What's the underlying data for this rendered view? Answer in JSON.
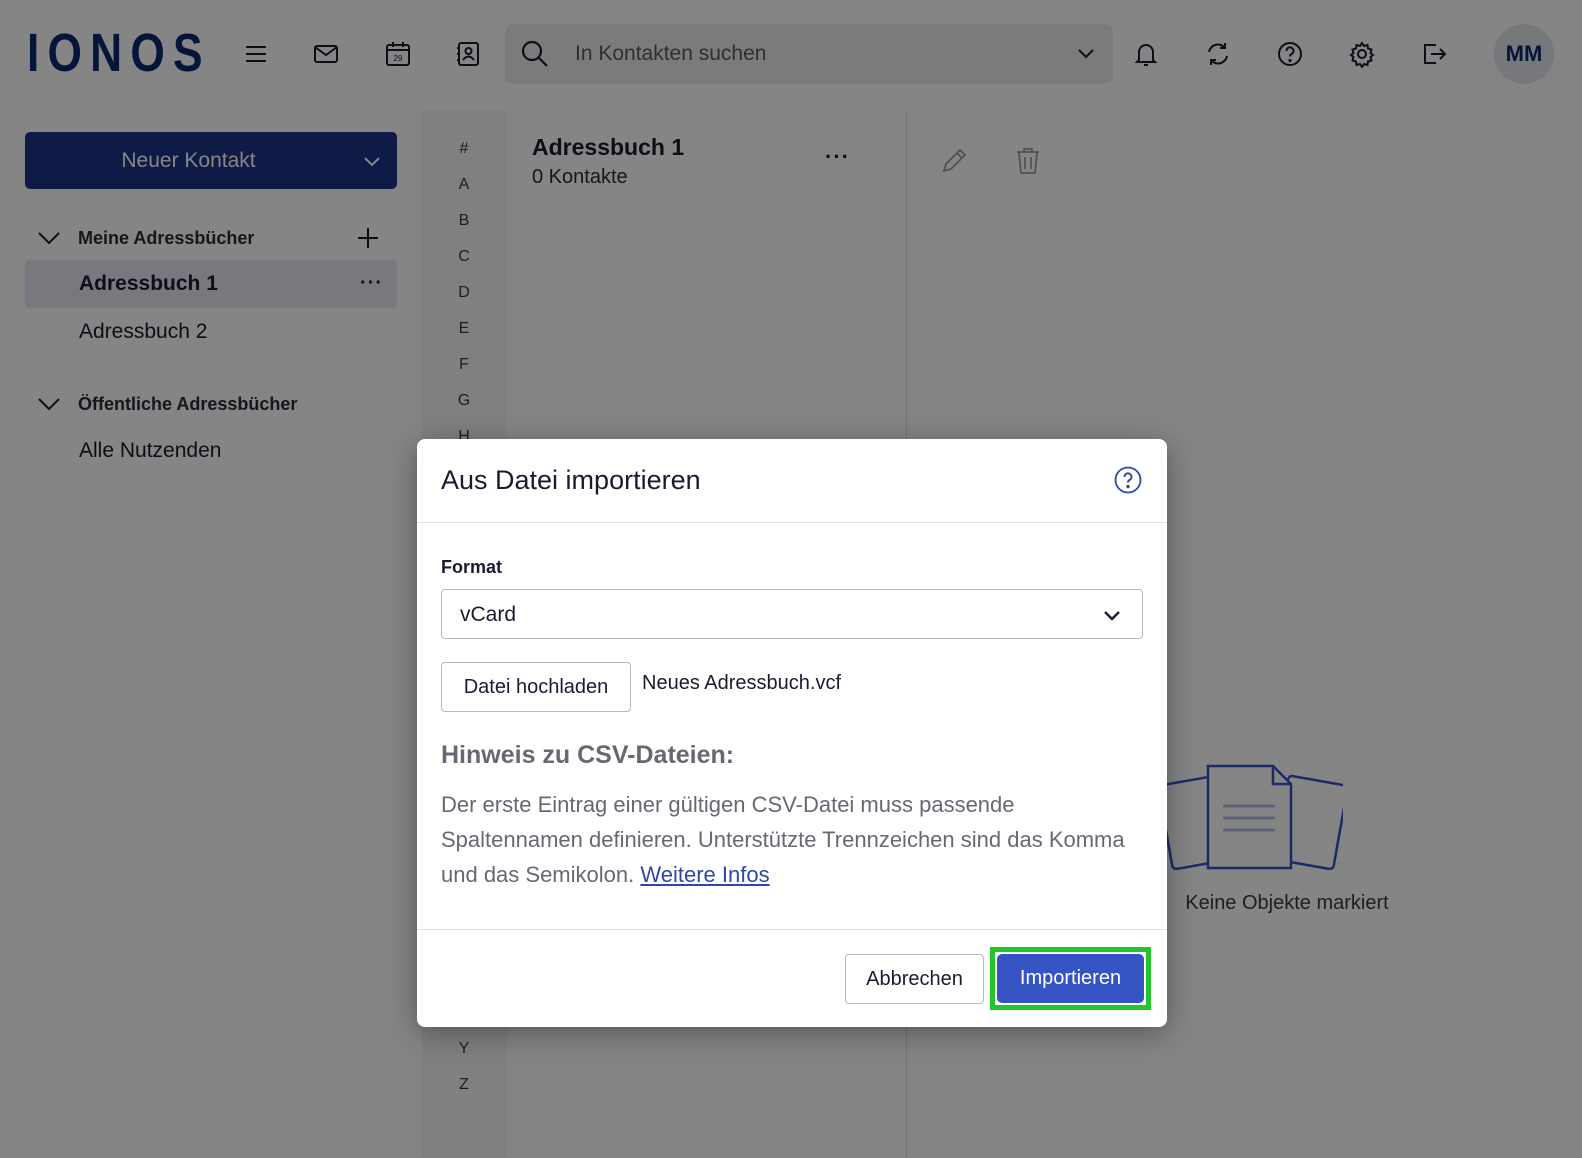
{
  "header": {
    "logo": "IONOS",
    "search_placeholder": "In Kontakten suchen",
    "avatar_initials": "MM",
    "calendar_day": "29"
  },
  "sidebar": {
    "new_contact_label": "Neuer Kontakt",
    "my_books_heading": "Meine Adressbücher",
    "books": [
      {
        "label": "Adressbuch 1",
        "active": true
      },
      {
        "label": "Adressbuch 2",
        "active": false
      }
    ],
    "public_books_heading": "Öffentliche Adressbücher",
    "public_books": [
      {
        "label": "Alle Nutzenden"
      }
    ]
  },
  "alphabet": [
    "#",
    "A",
    "B",
    "C",
    "D",
    "E",
    "F",
    "G",
    "H",
    "Y",
    "Z"
  ],
  "list": {
    "title": "Adressbuch 1",
    "count": "0 Kontakte",
    "more": "···"
  },
  "detail": {
    "empty_text": "Keine Objekte markiert"
  },
  "dialog": {
    "title": "Aus Datei importieren",
    "format_label": "Format",
    "format_value": "vCard",
    "upload_label": "Datei hochladen",
    "file_name": "Neues Adressbuch.vcf",
    "hint_heading": "Hinweis zu CSV-Dateien:",
    "hint_text": "Der erste Eintrag einer gültigen CSV-Datei muss passende Spaltennamen definieren. Unterstützte Trennzeichen sind das Komma und das Semikolon.",
    "hint_link": "Weitere Infos",
    "cancel_label": "Abbrechen",
    "import_label": "Importieren"
  },
  "colors": {
    "brand": "#0b2a6f",
    "primary_button": "#1f3387",
    "import_button": "#3653c4",
    "highlight": "#22c52a"
  }
}
